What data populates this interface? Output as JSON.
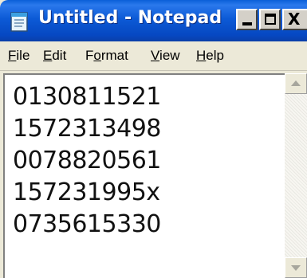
{
  "window": {
    "title": "Untitled - Notepad",
    "controls": {
      "close_glyph": "X"
    }
  },
  "menu": {
    "items": [
      {
        "mnemonic": "F",
        "rest": "ile"
      },
      {
        "mnemonic": "E",
        "rest": "dit"
      },
      {
        "pre": "F",
        "mnemonic": "o",
        "rest": "rmat"
      },
      {
        "mnemonic": "V",
        "rest": "iew"
      },
      {
        "mnemonic": "H",
        "rest": "elp"
      }
    ]
  },
  "editor": {
    "lines": [
      "0130811521",
      "1572313498",
      "0078820561",
      "157231995x",
      "0735615330"
    ]
  },
  "icons": {
    "app": "notepad-icon",
    "minimize": "minimize-icon",
    "maximize": "maximize-icon",
    "close": "close-icon",
    "scroll_up": "scroll-up-arrow-icon",
    "scroll_down": "scroll-down-arrow-icon"
  },
  "colors": {
    "titlebar": "#0a5fd8",
    "title_text": "#ffffff",
    "chrome": "#ece9d8",
    "editor_bg": "#ffffff",
    "text": "#111111"
  }
}
